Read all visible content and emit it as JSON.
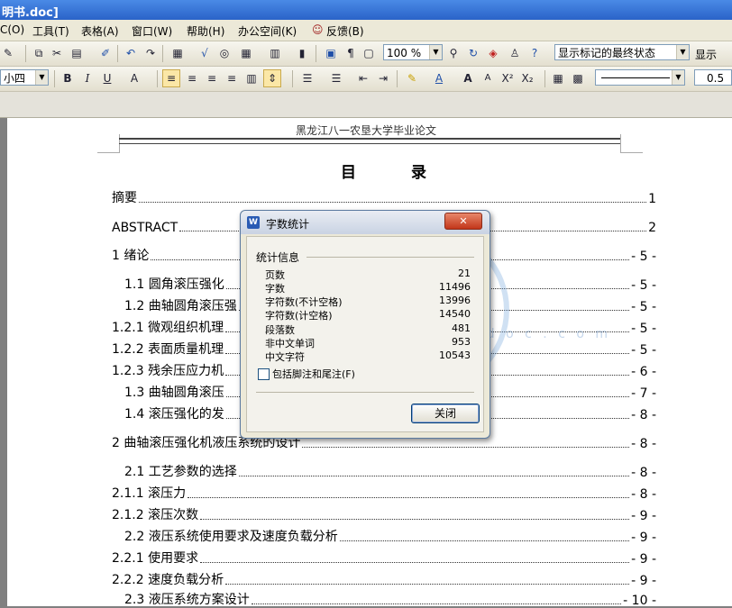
{
  "window": {
    "title": "明书.doc]"
  },
  "menu": [
    "C(O)",
    "工具(T)",
    "表格(A)",
    "窗口(W)",
    "帮助(H)",
    "办公空间(K)",
    "反馈(B)"
  ],
  "toolbar1": {
    "zoom": "100 %",
    "markup_mode": "显示标记的最终状态",
    "show_label": "显示"
  },
  "toolbar2": {
    "font_size": "小四",
    "line_width": "0.5",
    "bold": "B",
    "italic": "I",
    "underline": "U"
  },
  "document": {
    "header": "黑龙江八一农垦大学毕业论文",
    "toc_title": "目　录",
    "toc": [
      {
        "text": "摘要",
        "page": "1"
      },
      {
        "text": "ABSTRACT",
        "page": "2"
      },
      {
        "text": "1 绪论",
        "page": "- 5 -"
      },
      {
        "text": "1.1 圆角滚压强化",
        "page": "- 5 -"
      },
      {
        "text": "1.2 曲轴圆角滚压强",
        "page": "- 5 -"
      },
      {
        "text": "1.2.1 微观组织机理",
        "page": "- 5 -"
      },
      {
        "text": "1.2.2 表面质量机理",
        "page": "- 5 -"
      },
      {
        "text": "1.2.3 残余压应力机",
        "page": "- 6 -"
      },
      {
        "text": "1.3 曲轴圆角滚压",
        "page": "- 7 -"
      },
      {
        "text": "1.4 滚压强化的发",
        "page": "- 8 -"
      },
      {
        "text": "2 曲轴滚压强化机液压系统的设计",
        "page": "- 8 -"
      },
      {
        "text": "2.1 工艺参数的选择",
        "page": "- 8 -"
      },
      {
        "text": "2.1.1 滚压力",
        "page": "- 8 -"
      },
      {
        "text": "2.1.2 滚压次数",
        "page": "- 9 -"
      },
      {
        "text": "2.2 液压系统使用要求及速度负载分析",
        "page": "- 9 -"
      },
      {
        "text": "2.2.1 使用要求",
        "page": "- 9 -"
      },
      {
        "text": "2.2.2 速度负载分析",
        "page": "- 9 -"
      },
      {
        "text": "2.3 液压系统方案设计",
        "page": "- 10 -"
      }
    ]
  },
  "watermark": {
    "text": "w w w . r e n r e n d o c . c o m"
  },
  "dialog": {
    "title": "字数统计",
    "group": "统计信息",
    "stats": [
      {
        "label": "页数",
        "value": "21"
      },
      {
        "label": "字数",
        "value": "11496"
      },
      {
        "label": "字符数(不计空格)",
        "value": "13996"
      },
      {
        "label": "字符数(计空格)",
        "value": "14540"
      },
      {
        "label": "段落数",
        "value": "481"
      },
      {
        "label": "非中文单词",
        "value": "953"
      },
      {
        "label": "中文字符",
        "value": "10543"
      }
    ],
    "checkbox_label": "包括脚注和尾注(F)",
    "close_button": "关闭"
  }
}
